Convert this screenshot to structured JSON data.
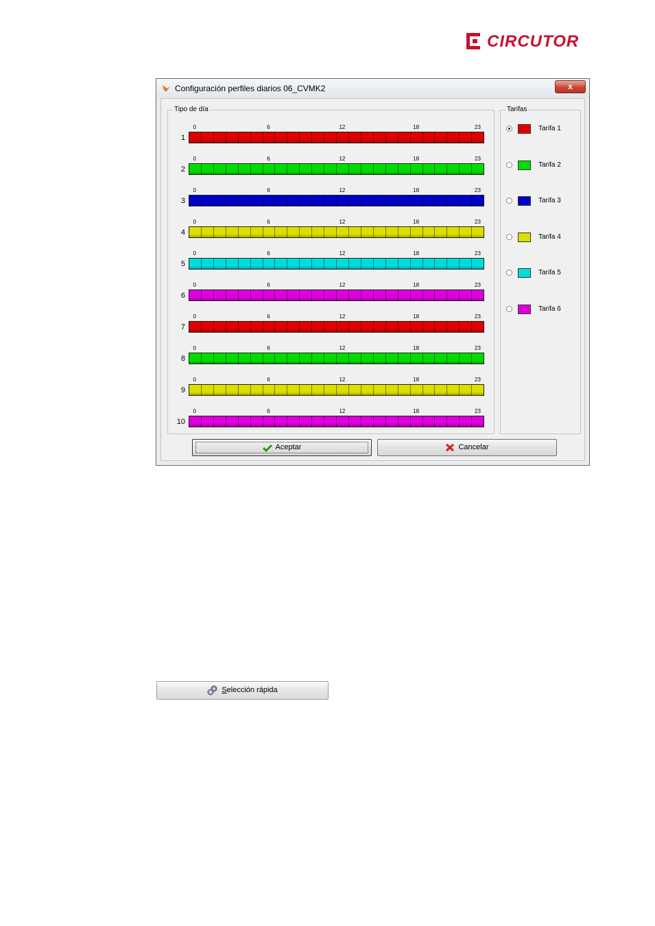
{
  "logo": {
    "text": "CIRCUTOR",
    "color": "#c8102e"
  },
  "window": {
    "title": "Configuración perfiles diarios 06_CVMK2",
    "close_label": "x"
  },
  "day_group": {
    "label": "Tipo de día",
    "hour_ticks": [
      "0",
      "6",
      "12",
      "18",
      "23"
    ],
    "days": [
      {
        "num": "1",
        "tarifa": 1
      },
      {
        "num": "2",
        "tarifa": 2
      },
      {
        "num": "3",
        "tarifa": 3
      },
      {
        "num": "4",
        "tarifa": 4
      },
      {
        "num": "5",
        "tarifa": 5
      },
      {
        "num": "6",
        "tarifa": 6
      },
      {
        "num": "7",
        "tarifa": 1
      },
      {
        "num": "8",
        "tarifa": 2
      },
      {
        "num": "9",
        "tarifa": 4
      },
      {
        "num": "10",
        "tarifa": 6
      }
    ]
  },
  "tarifas_group": {
    "label": "Tarifas",
    "selected": 1,
    "items": [
      {
        "label": "Tarifa 1",
        "color": "#e00000"
      },
      {
        "label": "Tarifa 2",
        "color": "#00dd00"
      },
      {
        "label": "Tarifa 3",
        "color": "#0000cc"
      },
      {
        "label": "Tarifa 4",
        "color": "#dddd00"
      },
      {
        "label": "Tarifa 5",
        "color": "#00dddd"
      },
      {
        "label": "Tarifa 6",
        "color": "#dd00dd"
      }
    ]
  },
  "buttons": {
    "accept": "Aceptar",
    "cancel": "Cancelar"
  },
  "quick_button": {
    "underlined": "S",
    "rest": "elección rápida"
  }
}
